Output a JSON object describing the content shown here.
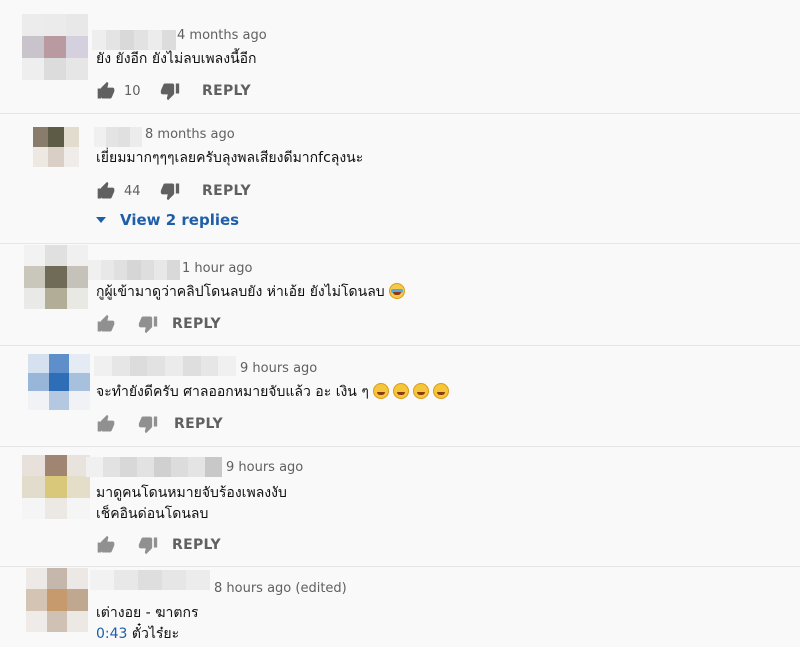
{
  "reply_label": "REPLY",
  "comments": [
    {
      "time": "4 months ago",
      "text": "ยัง ยังอีก ยังไม่ลบเพลงนี้อีก",
      "likes": "10",
      "avatar_colors": [
        "#ececec",
        "#ebebeb",
        "#e8e8e8",
        "#c9c3cc",
        "#b99aa0",
        "#d5d0dd",
        "#eeeeee",
        "#dcdcdc",
        "#e6e6e6"
      ],
      "name_blur_colors": [
        "#eeeeee",
        "#e4e4e4",
        "#d9d9d9",
        "#e2e2e2",
        "#ececec",
        "#dcdcdc"
      ]
    },
    {
      "time": "8 months ago",
      "text": "เยี่ยมมากๆๆๆเลยครับลุงพลเสียงดีมากfcลุงนะ",
      "likes": "44",
      "view_replies": "View 2 replies",
      "avatar_colors": [
        "#8a7c6a",
        "#5d5b46",
        "#e2dccf",
        "#ede8e2",
        "#d9cfc6",
        "#f0ecea"
      ],
      "name_blur_colors": [
        "#f0f0f0",
        "#e4e4e4",
        "#e0e0e0",
        "#ececec"
      ]
    },
    {
      "time": "1 hour ago",
      "text": "กูผู้เข้ามาดูว่าคลิปโดนลบยัง ห่าเอ้ย ยังไม่โดนลบ",
      "likes": "",
      "avatar_colors": [
        "#f2f2f2",
        "#e0e0e0",
        "#f0f0f0",
        "#c9c6bc",
        "#6f6b57",
        "#c5c2b9",
        "#e9e9e7",
        "#b2ad97",
        "#e9e9e4"
      ],
      "name_blur_colors": [
        "#f0f0f0",
        "#e8e8e8",
        "#e0e0e0",
        "#d6d6d6",
        "#dedede",
        "#e8e8e8",
        "#d9d9d9"
      ]
    },
    {
      "time": "9 hours ago",
      "text": "จะทำยังดีครับ ศาลออกหมายจับแล้ว อะ เงิน ๆ",
      "likes": "",
      "avatar_colors": [
        "#d5e1ee",
        "#5f8fcb",
        "#e4ebf4",
        "#98b6da",
        "#2e6eb7",
        "#a7c0de",
        "#f0f2f6",
        "#b5c8e1",
        "#f0f2f6"
      ],
      "name_blur_colors": [
        "#f0f0f0",
        "#e6e6e6",
        "#dcdcdc",
        "#e2e2e2",
        "#ebebeb",
        "#dedede",
        "#e6e6e6",
        "#f0f0f0"
      ]
    },
    {
      "time": "9 hours ago",
      "text": "มาดูคนโดนหมายจับร้องเพลงงับ",
      "text2": "เช็คอินด่อนโดนลบ",
      "likes": "",
      "avatar_colors": [
        "#e8e0da",
        "#a08672",
        "#e9e3de",
        "#e2dccc",
        "#d9c87a",
        "#e4dec8",
        "#f5f5f5",
        "#ece9e4",
        "#f5f5f5"
      ],
      "name_blur_colors": [
        "#f0f0f0",
        "#e2e2e2",
        "#d8d8d8",
        "#e2e2e2",
        "#d0d0d0",
        "#dcdcdc",
        "#e4e4e4",
        "#c8c8c8"
      ]
    },
    {
      "time": "8 hours ago (edited)",
      "text": "เต่างอย - ฆาตกร",
      "timestamp_link": "0:43",
      "text2_after_link": "ตั๋วไร๋ยะ",
      "avatar_colors": [
        "#ece9e6",
        "#c5b7ab",
        "#ebe8e5",
        "#d4c4b4",
        "#c69a6c",
        "#bfa88f",
        "#eeebe8",
        "#cfc1b4",
        "#ece8e4"
      ],
      "name_blur_colors": [
        "#f2f2f2",
        "#e8e8e8",
        "#dedede",
        "#e6e6e6",
        "#ececec"
      ]
    }
  ]
}
